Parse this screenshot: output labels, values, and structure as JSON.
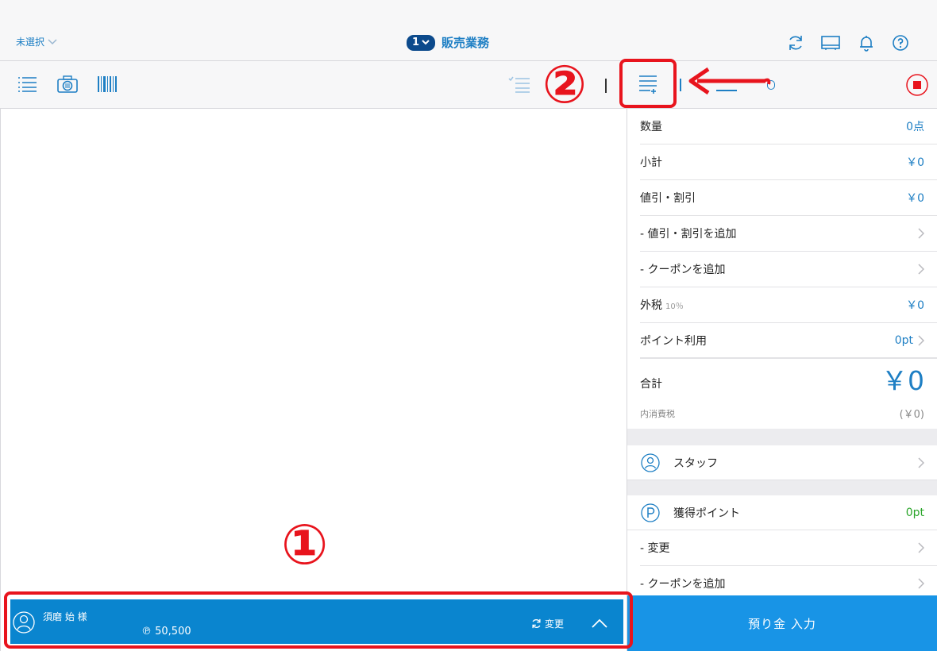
{
  "header": {
    "unselected_label": "未選択",
    "badge_number": "1",
    "title": "販売業務"
  },
  "icons": {
    "header": [
      "refresh-icon",
      "display-icon",
      "bell-icon",
      "help-icon"
    ],
    "toolbar_left": [
      "list-icon",
      "camera-icon",
      "barcode-icon"
    ],
    "toolbar_right": [
      "checklist-icon",
      "add-list-icon",
      "stop-icon"
    ]
  },
  "summary": {
    "quantity_label": "数量",
    "quantity_value": "0点",
    "subtotal_label": "小計",
    "subtotal_value": "￥0",
    "discount_label": "値引・割引",
    "discount_value": "￥0",
    "add_discount_label": "- 値引・割引を追加",
    "add_coupon_label": "- クーポンを追加",
    "tax_label": "外税",
    "tax_rate": "10％",
    "tax_value": "￥0",
    "points_label": "ポイント利用",
    "points_value": "0pt",
    "total_label": "合計",
    "total_value": "￥0",
    "inner_tax_label": "内消費税",
    "inner_tax_value": "(￥0)"
  },
  "staff": {
    "label": "スタッフ"
  },
  "earned": {
    "label": "獲得ポイント",
    "value": "0pt",
    "change_label": "- 変更",
    "add_coupon_label": "- クーポンを追加"
  },
  "customer": {
    "name": "須磨 始 様",
    "points": "℗ 50,500",
    "change_label": "変更"
  },
  "deposit_button": "預り金 入力",
  "annotations": {
    "one": "①",
    "two": "②"
  },
  "colors": {
    "accent": "#1e7fc4",
    "highlight": "#e8141d",
    "customer_bar": "#0a85cf",
    "deposit": "#1894e6",
    "earned_points": "#2aa52a"
  }
}
